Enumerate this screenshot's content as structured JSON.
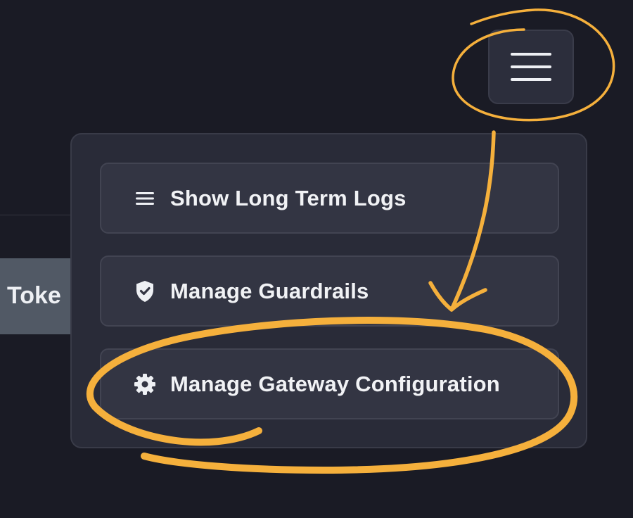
{
  "background_tab": {
    "label": "Toke"
  },
  "header": {
    "menu_button_icon": "hamburger-menu-icon"
  },
  "dropdown_menu": {
    "items": [
      {
        "label": "Show Long Term Logs",
        "icon": "list-icon"
      },
      {
        "label": "Manage Guardrails",
        "icon": "shield-check-icon"
      },
      {
        "label": "Manage Gateway Configuration",
        "icon": "gear-icon"
      }
    ]
  },
  "annotations": {
    "color": "#f5b03c",
    "marks": [
      "circle-around-menu-button",
      "arrow-to-gateway-item",
      "circle-around-gateway-item"
    ]
  },
  "colors": {
    "page_background": "#1a1b25",
    "dropdown_background": "#292b38",
    "item_background": "#333543",
    "text": "#f1f2f5",
    "annotation": "#f5b03c"
  }
}
